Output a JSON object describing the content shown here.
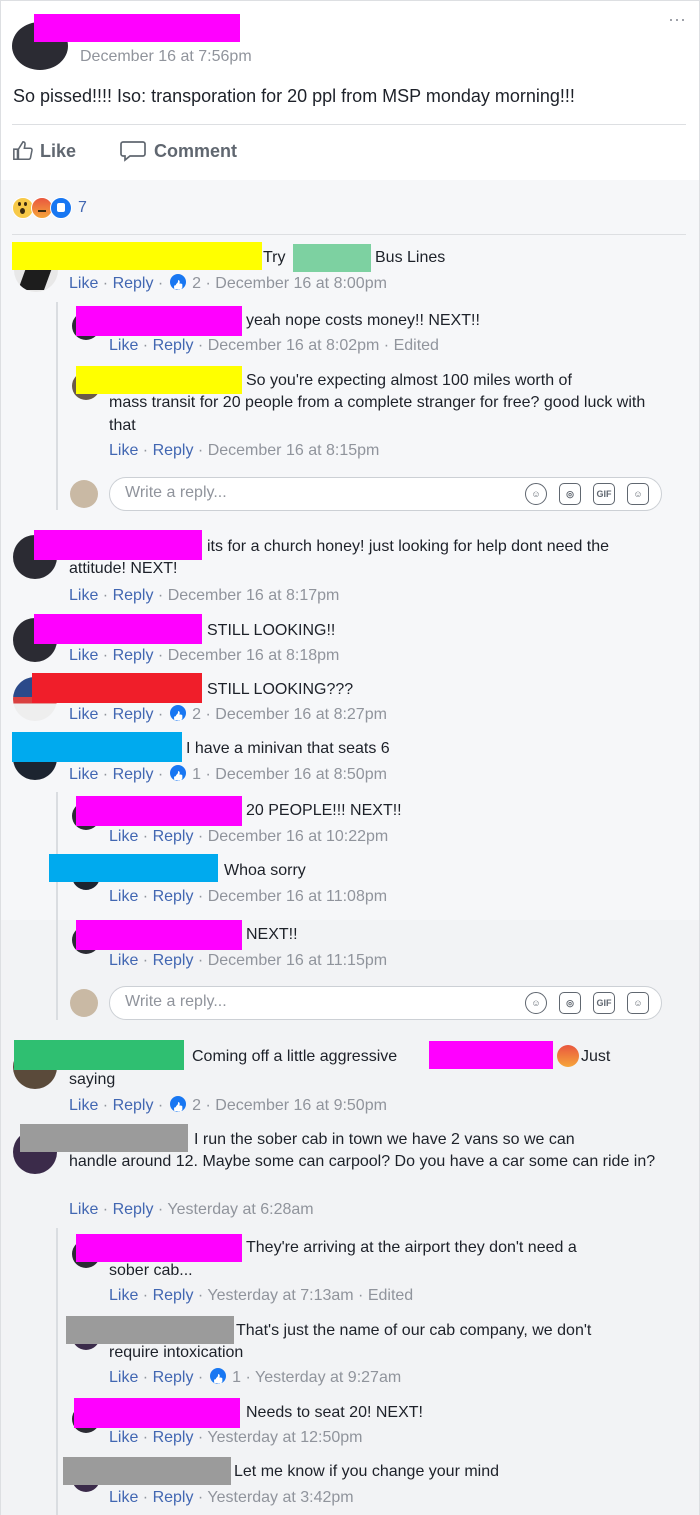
{
  "post": {
    "date": "December 16 at 7:56pm",
    "text": "So pissed!!!! Iso: transporation for 20 ppl from MSP monday morning!!!",
    "more": "···",
    "like_label": "Like",
    "comment_label": "Comment",
    "reaction_count": "7",
    "reaction_icons": [
      "wow-reaction-icon",
      "angry-reaction-icon",
      "like-reaction-icon"
    ]
  },
  "meta_words": {
    "like": "Like",
    "reply": "Reply",
    "dot": " · "
  },
  "reply_placeholder": "Write a reply...",
  "comments": {
    "c1": {
      "text_a": "Try",
      "text_b": "Bus Lines",
      "likes": "2",
      "date": "December 16 at 8:00pm"
    },
    "r1": {
      "text": "yeah nope costs money!! NEXT!!",
      "date": "December 16 at 8:02pm",
      "edited": "Edited"
    },
    "r2": {
      "text_first": "So you're expecting almost 100 miles worth of",
      "text_rest": "mass transit for 20 people from a complete stranger for free? good luck with that",
      "date": "December 16 at 8:15pm"
    },
    "c2": {
      "text_first": "its for a church honey! just looking for help dont need the",
      "text_rest": "attitude! NEXT!",
      "date": "December 16 at 8:17pm"
    },
    "c3": {
      "text": "STILL LOOKING!!",
      "date": "December 16 at 8:18pm"
    },
    "c4": {
      "text": "STILL LOOKING???",
      "likes": "2",
      "date": "December 16 at 8:27pm"
    },
    "c5": {
      "text": "I have a minivan that seats 6",
      "likes": "1",
      "date": "December 16 at 8:50pm"
    },
    "r3": {
      "text": "20 PEOPLE!!! NEXT!!",
      "date": "December 16 at 10:22pm"
    },
    "r4": {
      "text": "Whoa sorry",
      "date": "December 16 at 11:08pm"
    },
    "r5": {
      "text": "NEXT!!",
      "date": "December 16 at 11:15pm"
    },
    "c6": {
      "text_a": "Coming off a little aggressive",
      "text_b": "Just",
      "text_rest": "saying",
      "likes": "2",
      "date": "December 16 at 9:50pm"
    },
    "c7": {
      "text_first": "I run the sober cab in town we have 2 vans so we can",
      "text_rest": "handle around 12. Maybe some can carpool? Do you have a car some can ride in?",
      "date": "Yesterday at 6:28am"
    },
    "r6": {
      "text_first": "They're arriving at the airport they don't need a",
      "text_rest": "sober cab...",
      "date": "Yesterday at 7:13am",
      "edited": "Edited"
    },
    "r7": {
      "text_first": "That's just the name of our cab company, we don't",
      "text_rest": "require intoxication",
      "likes": "1",
      "date": "Yesterday at 9:27am"
    },
    "r8": {
      "text": "Needs to seat 20! NEXT!",
      "date": "Yesterday at 12:50pm"
    },
    "r9": {
      "text": "Let me know if you change your mind",
      "date": "Yesterday at 3:42pm"
    }
  }
}
